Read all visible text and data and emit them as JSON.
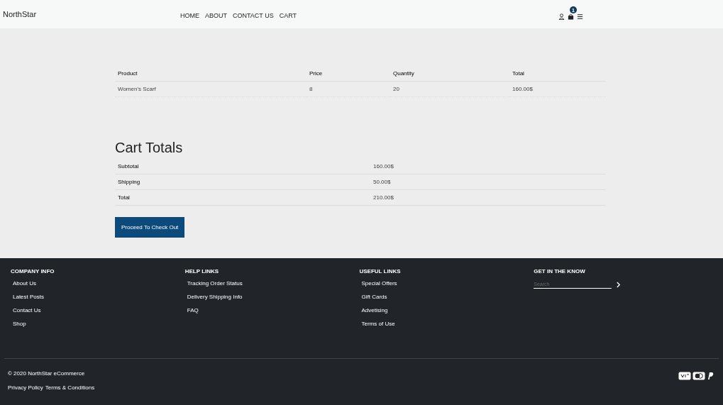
{
  "header": {
    "brand": "NorthStar",
    "nav": [
      {
        "label": "HOME"
      },
      {
        "label": "ABOUT"
      },
      {
        "label": "CONTACT US"
      },
      {
        "label": "CART"
      }
    ],
    "cart_count": "1"
  },
  "cart_table": {
    "columns": [
      "Product",
      "Price",
      "Quantity",
      "Total"
    ],
    "rows": [
      [
        "Women's Scarf",
        "8",
        "20",
        "160.00$"
      ]
    ]
  },
  "cart_totals": {
    "title": "Cart Totals",
    "rows": [
      {
        "label": "Subtotal",
        "value": "160.00$"
      },
      {
        "label": "Shipping",
        "value": "50.00$"
      },
      {
        "label": "Total",
        "value": "210.00$"
      }
    ],
    "button": "Proceed To Check Out"
  },
  "footer": {
    "columns": [
      {
        "title": "COMPANY INFO",
        "links": [
          "About Us",
          "Latest Posts",
          "Contact Us",
          "Shop"
        ]
      },
      {
        "title": "HELP LINKS",
        "links": [
          "Tracking Order Status",
          "Delivery Shipping Info",
          "FAQ"
        ]
      },
      {
        "title": "USEFUL LINKS",
        "links": [
          "Special Offers",
          "Gift Cards",
          "Advetising",
          "Terms of Use"
        ]
      }
    ],
    "newsletter": {
      "title": "GET IN THE KNOW",
      "placeholder": "Search"
    },
    "copyright": "© 2020 NorthStar eCommerce",
    "legal_links": [
      "Privacy Policy",
      "Terms & Conditions"
    ]
  }
}
